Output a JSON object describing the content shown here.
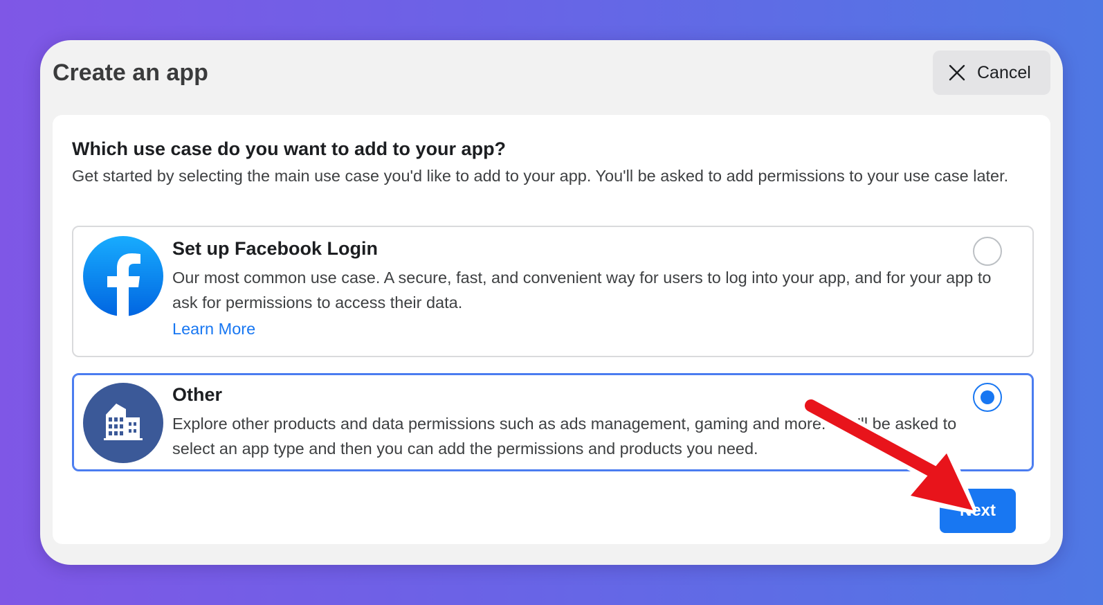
{
  "window": {
    "title": "Create an app",
    "cancel_label": "Cancel"
  },
  "question": {
    "title": "Which use case do you want to add to your app?",
    "description": "Get started by selecting the main use case you'd like to add to your app. You'll be asked to add permissions to your use case later."
  },
  "options": [
    {
      "title": "Set up Facebook Login",
      "description": "Our most common use case. A secure, fast, and convenient way for users to log into your app, and for your app to ask for permissions to access their data.",
      "link": "Learn More",
      "icon": "facebook-icon",
      "selected": false
    },
    {
      "title": "Other",
      "description": "Explore other products and data permissions such as ads management, gaming and more. You'll be asked to select an app type and then you can add the permissions and products you need.",
      "icon": "building-icon",
      "selected": true
    }
  ],
  "footer": {
    "next_label": "Next"
  },
  "colors": {
    "accent": "#1877f2",
    "annotation_arrow": "#e8141b",
    "other_icon_bg": "#3b5998"
  }
}
